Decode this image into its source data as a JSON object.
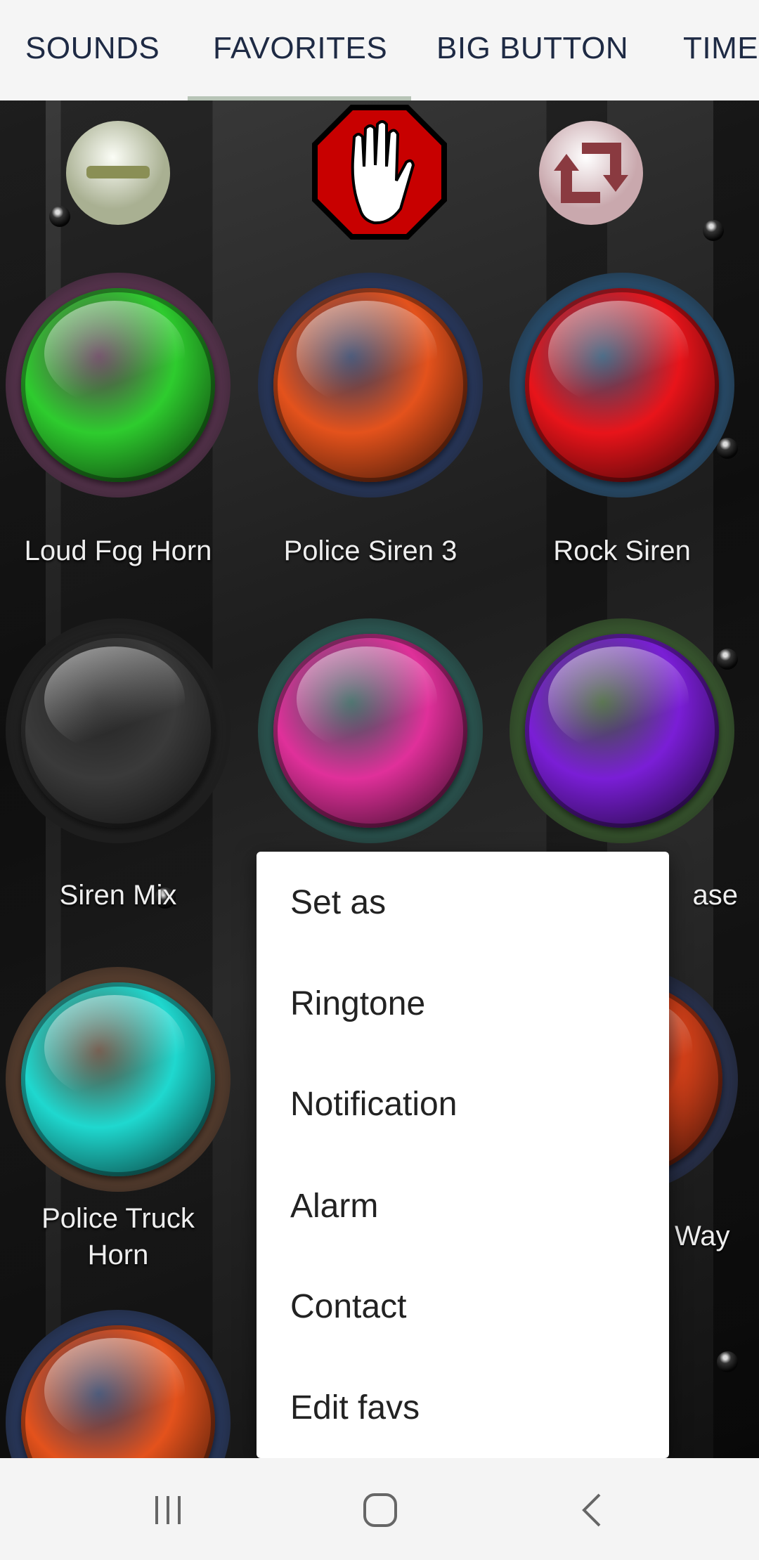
{
  "tabs": [
    {
      "label": "SOUNDS"
    },
    {
      "label": "FAVORITES",
      "selected": true
    },
    {
      "label": "BIG BUTTON"
    },
    {
      "label": "TIME"
    }
  ],
  "toolbar": {
    "icons": [
      "minus-icon",
      "stop-hand-icon",
      "repeat-icon"
    ]
  },
  "sounds": [
    {
      "label": "Loud Fog Horn",
      "color": "#2ecc2e"
    },
    {
      "label": "Police Siren 3",
      "color": "#e4521c"
    },
    {
      "label": "Rock Siren",
      "color": "#e8141a"
    },
    {
      "label": "Siren Mix",
      "color": "#3a3a3a"
    },
    {
      "label": "",
      "color": "#e0309a"
    },
    {
      "label": "ase",
      "color": "#7a1ed6"
    },
    {
      "label": "Police Truck Horn",
      "color": "#1fd8cf"
    },
    {
      "label": "Way",
      "color": "#d9421a"
    },
    {
      "label": "",
      "color": "#e4521c"
    }
  ],
  "context_menu": {
    "title": "Set as",
    "items": [
      "Ringtone",
      "Notification",
      "Alarm",
      "Contact",
      "Edit favs"
    ]
  },
  "navbar": {
    "icons": [
      "recent-apps-icon",
      "home-icon",
      "back-icon"
    ]
  }
}
